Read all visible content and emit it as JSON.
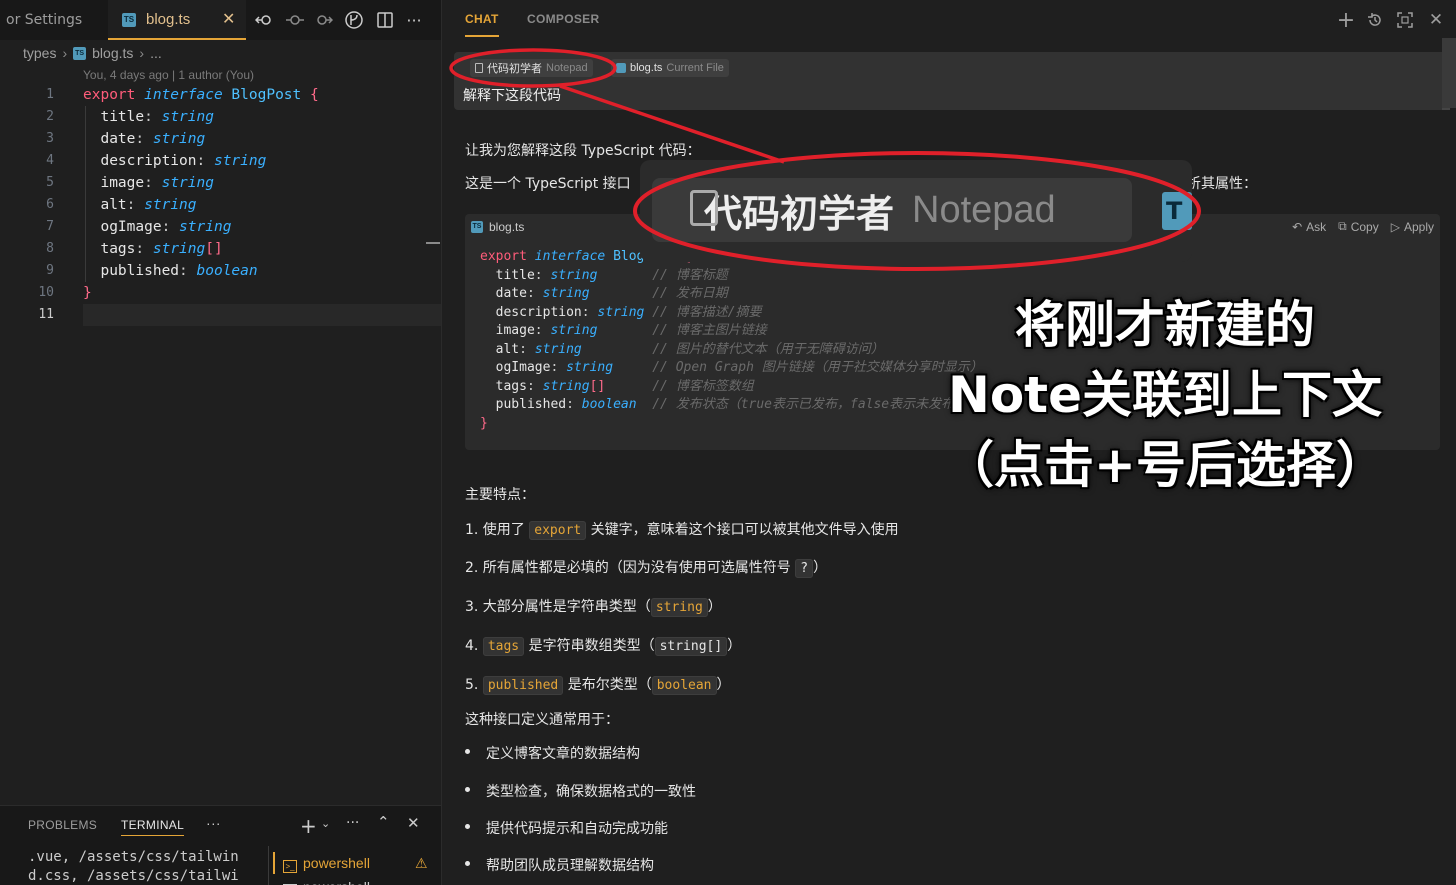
{
  "editor": {
    "prev_tab_label": "or Settings",
    "active_tab": {
      "label": "blog.ts",
      "badge": "TS",
      "close": "✕"
    },
    "breadcrumb": {
      "folder": "types",
      "file": "blog.ts",
      "more": "..."
    },
    "codelens": "You, 4 days ago | 1 author (You)",
    "line_numbers": [
      "1",
      "2",
      "3",
      "4",
      "5",
      "6",
      "7",
      "8",
      "9",
      "10",
      "11"
    ],
    "code_lines": [
      [
        "export",
        " interface",
        " BlogPost",
        " {"
      ],
      [
        "title",
        ": ",
        "string"
      ],
      [
        "date",
        ": ",
        "string"
      ],
      [
        "description",
        ": ",
        "string"
      ],
      [
        "image",
        ": ",
        "string"
      ],
      [
        "alt",
        ": ",
        "string"
      ],
      [
        "ogImage",
        ": ",
        "string"
      ],
      [
        "tags",
        ": ",
        "string",
        "[]"
      ],
      [
        "published",
        ": ",
        "boolean"
      ],
      [
        "}"
      ]
    ]
  },
  "panel": {
    "tabs": {
      "problems": "PROBLEMS",
      "terminal": "TERMINAL",
      "more": "···"
    },
    "terminal_text": ".vue, /assets/css/tailwin\nd.css, /assets/css/tailwi",
    "terminals": [
      "powershell",
      "powershell"
    ],
    "warning": "⚠"
  },
  "chat": {
    "tabs": {
      "chat": "CHAT",
      "composer": "COMPOSER"
    },
    "context_pills": [
      {
        "name": "代码初学者",
        "kind": "Notepad"
      },
      {
        "name": "blog.ts",
        "kind": "Current File"
      }
    ],
    "user_message": "解释下这段代码",
    "intro": "让我为您解释这段 TypeScript 代码：",
    "intro2_a": "这是一个 TypeScript 接口（Interf",
    "intro2_b": "逐个解析其属性：",
    "code_block": {
      "filename": "blog.ts",
      "actions": {
        "ask": "Ask",
        "copy": "Copy",
        "apply": "Apply"
      },
      "lines": [
        {
          "k": "prop",
          "v": "title",
          "t": "string",
          "pad": "       ",
          "c": "// 博客标题"
        },
        {
          "k": "prop",
          "v": "date",
          "t": "string",
          "pad": "        ",
          "c": "// 发布日期"
        },
        {
          "k": "prop",
          "v": "description",
          "t": "string",
          "pad": " ",
          "c": "// 博客描述/摘要"
        },
        {
          "k": "prop",
          "v": "image",
          "t": "string",
          "pad": "       ",
          "c": "// 博客主图片链接"
        },
        {
          "k": "prop",
          "v": "alt",
          "t": "string",
          "pad": "         ",
          "c": "// 图片的替代文本（用于无障碍访问）"
        },
        {
          "k": "prop",
          "v": "ogImage",
          "t": "string",
          "pad": "     ",
          "c": "// Open Graph 图片链接（用于社交媒体分享时显示）"
        },
        {
          "k": "prop",
          "v": "tags",
          "t": "string[]",
          "pad": "      ",
          "c": "// 博客标签数组"
        },
        {
          "k": "prop",
          "v": "published",
          "t": "boolean",
          "pad": "  ",
          "c": "// 发布状态（true表示已发布，false表示未发布）"
        }
      ]
    },
    "features_title": "主要特点：",
    "features": [
      {
        "pre": "1. 使用了 ",
        "code": "export",
        "post": " 关键字，意味着这个接口可以被其他文件导入使用"
      },
      {
        "pre": "2. 所有属性都是必填的（因为没有使用可选属性符号 ",
        "code": "?",
        "post": "）"
      },
      {
        "pre": "3. 大部分属性是字符串类型（",
        "code": "string",
        "post": "）"
      },
      {
        "pre": "4. ",
        "code": "tags",
        "post": " 是字符串数组类型（",
        "code2": "string[]",
        "post2": "）"
      },
      {
        "pre": "5. ",
        "code": "published",
        "post": " 是布尔类型（",
        "code2": "boolean",
        "post2": "）"
      }
    ],
    "usage_title": "这种接口定义通常用于：",
    "usage": [
      "定义博客文章的数据结构",
      "类型检查，确保数据格式的一致性",
      "提供代码提示和自动完成功能",
      "帮助团队成员理解数据结构"
    ]
  },
  "annotation": {
    "zoom_name": "代码初学者",
    "zoom_kind": "Notepad",
    "caption_lines": [
      "将刚才新建的",
      "Note关联到上下文",
      "（点击+号后选择）"
    ],
    "color": "#e0202a"
  },
  "colors": {
    "accent": "#e5a537",
    "keyword": "#ff5c7a",
    "type": "#3ab0ff",
    "ts_badge": "#519aba"
  }
}
